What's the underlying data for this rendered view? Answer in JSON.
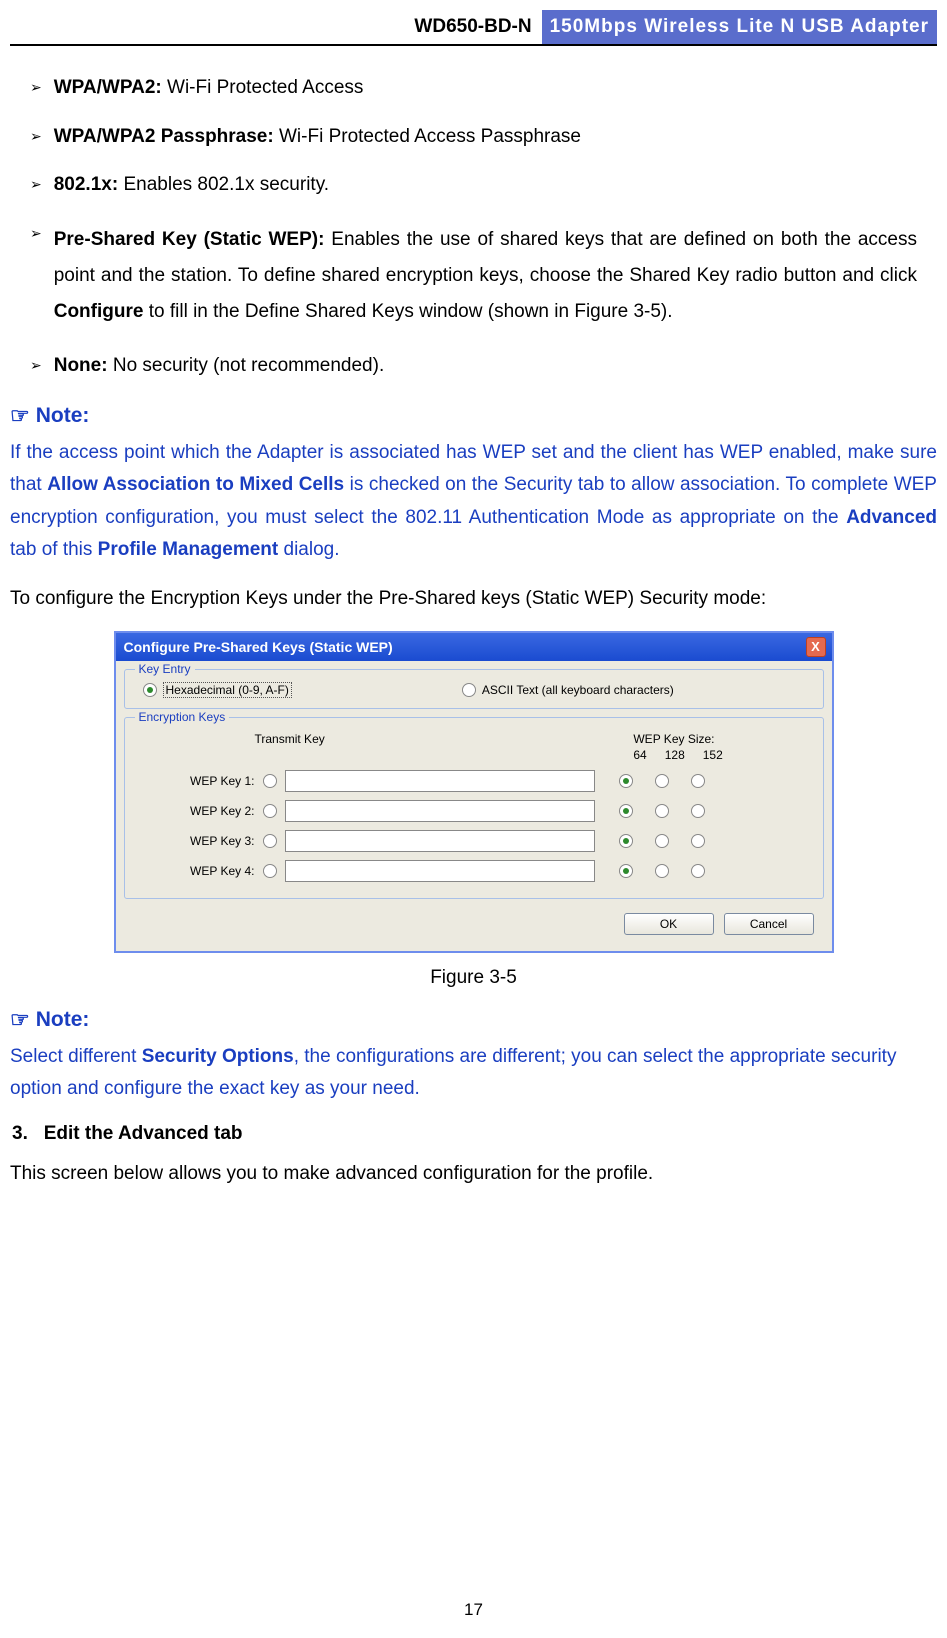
{
  "header": {
    "model": "WD650-BD-N",
    "title": "150Mbps  Wireless  Lite  N  USB  Adapter"
  },
  "bullets": [
    {
      "term": "WPA/WPA2:",
      "desc": "Wi-Fi Protected Access"
    },
    {
      "term": "WPA/WPA2 Passphrase:",
      "desc": "Wi-Fi Protected Access Passphrase"
    },
    {
      "term": "802.1x:",
      "desc": "Enables 802.1x security."
    },
    {
      "term": "Pre-Shared Key (Static WEP):",
      "desc_pre": "Enables the use of shared keys that are defined on both the access point and the station. To define shared encryption keys, choose the Shared Key radio button and click ",
      "desc_bold": "Configure",
      "desc_post": " to fill in the Define Shared Keys window (shown in Figure 3-5)."
    },
    {
      "term": "None:",
      "desc": "No security (not recommended)."
    }
  ],
  "note1": {
    "label": "Note:",
    "text_pre": "If the access point which the Adapter is associated has WEP set and the client has WEP enabled, make sure that ",
    "b1": "Allow Association to Mixed Cells",
    "text_mid": " is checked on the Security tab to allow association. To complete WEP encryption configuration, you must select the 802.11 Authentication Mode as appropriate on the ",
    "b2": "Advanced",
    "text_mid2": " tab of this ",
    "b3": "Profile Management",
    "text_post": " dialog."
  },
  "para_config": "To configure the Encryption Keys under the Pre-Shared keys (Static WEP) Security mode:",
  "dialog": {
    "title": "Configure Pre-Shared Keys (Static WEP)",
    "close": "X",
    "key_entry_legend": "Key Entry",
    "hex_label": "Hexadecimal (0-9, A-F)",
    "ascii_label": "ASCII Text (all keyboard characters)",
    "enc_legend": "Encryption Keys",
    "transmit": "Transmit Key",
    "size_header": "WEP Key Size:",
    "sizes": [
      "64",
      "128",
      "152"
    ],
    "keys": [
      "WEP Key 1:",
      "WEP Key 2:",
      "WEP Key 3:",
      "WEP Key 4:"
    ],
    "ok": "OK",
    "cancel": "Cancel"
  },
  "figure_caption": "Figure 3-5",
  "note2": {
    "label": "Note:",
    "text_pre": "Select different ",
    "b1": "Security Options",
    "text_post": ", the configurations are different; you can select the appropriate security option and configure the exact key as your need."
  },
  "section3_num": "3.",
  "section3_title": "Edit the Advanced tab",
  "para_adv": "This screen below allows you to make advanced configuration for the profile.",
  "page_number": "17"
}
